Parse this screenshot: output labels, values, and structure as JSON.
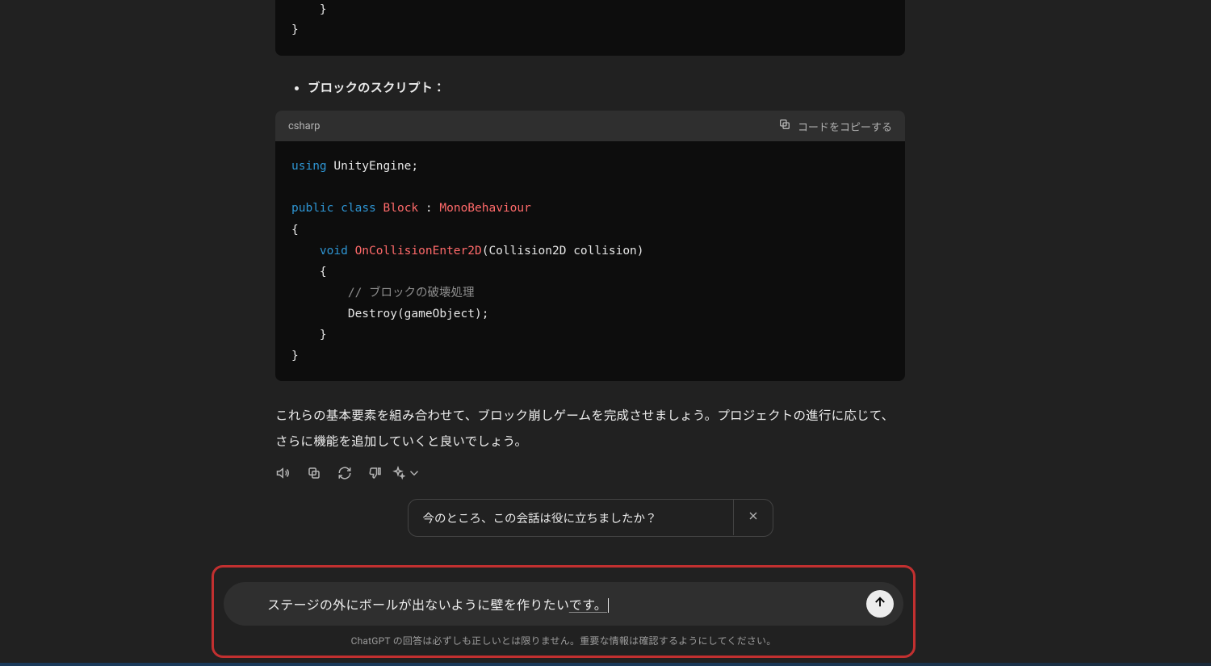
{
  "codeTop": {
    "line1": "    }",
    "line2": "}"
  },
  "bulletLabel": "ブロックのスクリプト：",
  "codeHeader": {
    "lang": "csharp",
    "copyLabel": "コードをコピーする"
  },
  "code": {
    "tokens": {
      "using": "using",
      "engine": " UnityEngine;",
      "public": "public",
      "class": "class",
      "blockName": "Block",
      "colon": " : ",
      "baseName": "MonoBehaviour",
      "openBrace": "{",
      "indent1": "    ",
      "void": "void",
      "method": "OnCollisionEnter2D",
      "params": "(Collision2D collision)",
      "openBrace2": "    {",
      "commentIndent": "        ",
      "comment": "// ブロックの破壊処理",
      "destroyIndent": "        ",
      "destroy": "Destroy(gameObject);",
      "closeBrace2": "    }",
      "closeBrace": "}"
    }
  },
  "summaryText": "これらの基本要素を組み合わせて、ブロック崩しゲームを完成させましょう。プロジェクトの進行に応じて、さらに機能を追加していくと良いでしょう。",
  "feedbackQuestion": "今のところ、この会話は役に立ちましたか？",
  "input": {
    "base": "ステージの外にボールが出ないように壁を作りたい",
    "underline": "です。"
  },
  "disclaimer": "ChatGPT の回答は必ずしも正しいとは限りません。重要な情報は確認するようにしてください。",
  "icons": {
    "copy": "copy-icon",
    "speaker": "speaker-icon",
    "copy2": "copy-icon",
    "regen": "refresh-icon",
    "thumbsDown": "thumbs-down-icon",
    "sparkle": "sparkle-icon",
    "thumbsUp": "thumbs-up-icon",
    "close": "close-icon",
    "attach": "paperclip-icon",
    "send": "arrow-up-icon"
  }
}
